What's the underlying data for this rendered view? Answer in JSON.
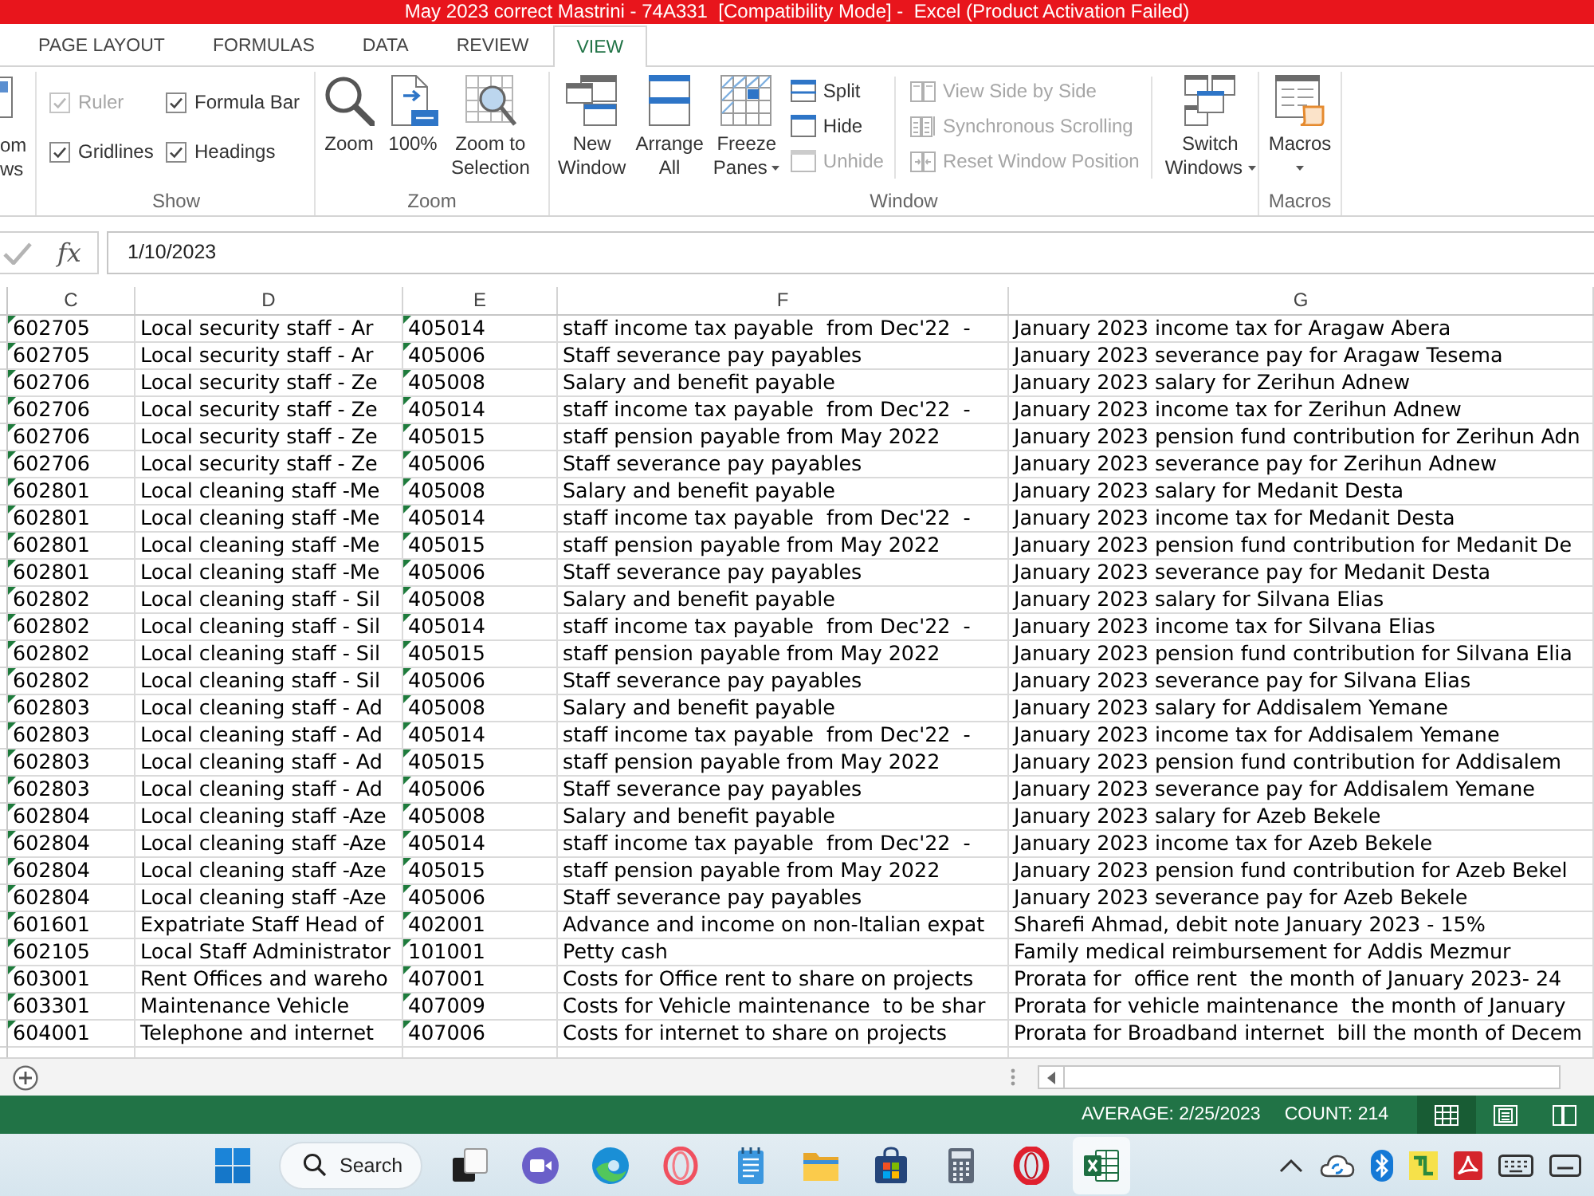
{
  "window": {
    "title": "May 2023 correct Mastrini - 74A331  [Compatibility Mode] -  Excel (Product Activation Failed)"
  },
  "ribbon": {
    "tabs": [
      {
        "label": "PAGE LAYOUT",
        "selected": false
      },
      {
        "label": "FORMULAS",
        "selected": false
      },
      {
        "label": "DATA",
        "selected": false
      },
      {
        "label": "REVIEW",
        "selected": false
      },
      {
        "label": "VIEW",
        "selected": true
      }
    ],
    "cut_button": {
      "lines": [
        "om",
        "ws"
      ]
    },
    "show": {
      "title": "Show",
      "options": [
        {
          "label": "Ruler",
          "checked": true,
          "disabled": true
        },
        {
          "label": "Formula Bar",
          "checked": true,
          "disabled": false
        },
        {
          "label": "Gridlines",
          "checked": true,
          "disabled": false
        },
        {
          "label": "Headings",
          "checked": true,
          "disabled": false
        }
      ]
    },
    "zoom": {
      "title": "Zoom",
      "buttons": [
        {
          "lines": [
            "Zoom"
          ]
        },
        {
          "lines": [
            "100%"
          ]
        },
        {
          "lines": [
            "Zoom to",
            "Selection"
          ]
        }
      ]
    },
    "window": {
      "title": "Window",
      "large": [
        {
          "lines": [
            "New",
            "Window"
          ],
          "dropdown": false
        },
        {
          "lines": [
            "Arrange",
            "All"
          ],
          "dropdown": false
        },
        {
          "lines": [
            "Freeze",
            "Panes"
          ],
          "dropdown": true
        }
      ],
      "small": [
        {
          "label": "Split",
          "disabled": false
        },
        {
          "label": "Hide",
          "disabled": false
        },
        {
          "label": "Unhide",
          "disabled": true
        }
      ],
      "compare": [
        {
          "label": "View Side by Side",
          "disabled": true
        },
        {
          "label": "Synchronous Scrolling",
          "disabled": true
        },
        {
          "label": "Reset Window Position",
          "disabled": true
        }
      ],
      "switch": {
        "lines": [
          "Switch",
          "Windows"
        ],
        "dropdown": true
      }
    },
    "macros": {
      "title": "Macros",
      "button": {
        "lines": [
          "Macros"
        ],
        "dropdown": true
      }
    }
  },
  "formula_bar": {
    "enter_disabled": true,
    "function_label": "fx",
    "value": "1/10/2023"
  },
  "table": {
    "columns": [
      {
        "label": "C",
        "flagged": true
      },
      {
        "label": "D",
        "flagged": false
      },
      {
        "label": "E",
        "flagged": true
      },
      {
        "label": "F",
        "flagged": false
      },
      {
        "label": "G",
        "flagged": false
      }
    ],
    "rows": [
      [
        "602705",
        "Local security staff - Ar",
        "405014",
        "staff income tax payable  from Dec'22  -",
        "January 2023 income tax for Aragaw Abera"
      ],
      [
        "602705",
        "Local security staff - Ar",
        "405006",
        "Staff severance pay payables",
        "January 2023 severance pay for Aragaw Tesema"
      ],
      [
        "602706",
        "Local security staff - Ze",
        "405008",
        "Salary and benefit payable",
        "January 2023 salary for Zerihun Adnew"
      ],
      [
        "602706",
        "Local security staff - Ze",
        "405014",
        "staff income tax payable  from Dec'22  -",
        "January 2023 income tax for Zerihun Adnew"
      ],
      [
        "602706",
        "Local security staff - Ze",
        "405015",
        "staff pension payable from May 2022",
        "January 2023 pension fund contribution for Zerihun Adn"
      ],
      [
        "602706",
        "Local security staff - Ze",
        "405006",
        "Staff severance pay payables",
        "January 2023 severance pay for Zerihun Adnew"
      ],
      [
        "602801",
        "Local cleaning staff -Me",
        "405008",
        "Salary and benefit payable",
        "January 2023 salary for Medanit Desta"
      ],
      [
        "602801",
        "Local cleaning staff -Me",
        "405014",
        "staff income tax payable  from Dec'22  -",
        "January 2023 income tax for Medanit Desta"
      ],
      [
        "602801",
        "Local cleaning staff -Me",
        "405015",
        "staff pension payable from May 2022",
        "January 2023 pension fund contribution for Medanit De"
      ],
      [
        "602801",
        "Local cleaning staff -Me",
        "405006",
        "Staff severance pay payables",
        "January 2023 severance pay for Medanit Desta"
      ],
      [
        "602802",
        "Local cleaning staff - Sil",
        "405008",
        "Salary and benefit payable",
        "January 2023 salary for Silvana Elias"
      ],
      [
        "602802",
        "Local cleaning staff - Sil",
        "405014",
        "staff income tax payable  from Dec'22  -",
        "January 2023 income tax for Silvana Elias"
      ],
      [
        "602802",
        "Local cleaning staff - Sil",
        "405015",
        "staff pension payable from May 2022",
        "January 2023 pension fund contribution for Silvana Elia"
      ],
      [
        "602802",
        "Local cleaning staff - Sil",
        "405006",
        "Staff severance pay payables",
        "January 2023 severance pay for Silvana Elias"
      ],
      [
        "602803",
        "Local cleaning staff - Ad",
        "405008",
        "Salary and benefit payable",
        "January 2023 salary for Addisalem Yemane"
      ],
      [
        "602803",
        "Local cleaning staff - Ad",
        "405014",
        "staff income tax payable  from Dec'22  -",
        "January 2023 income tax for Addisalem Yemane"
      ],
      [
        "602803",
        "Local cleaning staff - Ad",
        "405015",
        "staff pension payable from May 2022",
        "January 2023 pension fund contribution for Addisalem"
      ],
      [
        "602803",
        "Local cleaning staff - Ad",
        "405006",
        "Staff severance pay payables",
        "January 2023 severance pay for Addisalem Yemane"
      ],
      [
        "602804",
        "Local cleaning staff -Aze",
        "405008",
        "Salary and benefit payable",
        "January 2023 salary for Azeb Bekele"
      ],
      [
        "602804",
        "Local cleaning staff -Aze",
        "405014",
        "staff income tax payable  from Dec'22  -",
        "January 2023 income tax for Azeb Bekele"
      ],
      [
        "602804",
        "Local cleaning staff -Aze",
        "405015",
        "staff pension payable from May 2022",
        "January 2023 pension fund contribution for Azeb Bekel"
      ],
      [
        "602804",
        "Local cleaning staff -Aze",
        "405006",
        "Staff severance pay payables",
        "January 2023 severance pay for Azeb Bekele"
      ],
      [
        "601601",
        "Expatriate Staff Head of",
        "402001",
        "Advance and income on non-Italian expat",
        "Sharefi Ahmad, debit note January 2023 - 15%"
      ],
      [
        "602105",
        "Local Staff Administrator",
        "101001",
        "Petty cash",
        "Family medical reimbursement for Addis Mezmur"
      ],
      [
        "603001",
        "Rent Offices and wareho",
        "407001",
        "Costs for Office rent to share on projects",
        "Prorata for  office rent  the month of January 2023- 24"
      ],
      [
        "603301",
        "Maintenance Vehicle",
        "407009",
        "Costs for Vehicle maintenance  to be shar",
        "Prorata for vehicle maintenance  the month of January"
      ],
      [
        "604001",
        "Telephone and internet",
        "407006",
        "Costs for internet to share on projects",
        "Prorata for Broadband internet  bill the month of Decem"
      ]
    ]
  },
  "status_bar": {
    "stats": [
      "AVERAGE: 2/25/2023",
      "COUNT: 214"
    ],
    "views": [
      {
        "kind": "normal",
        "selected": true
      },
      {
        "kind": "page_layout",
        "selected": false
      },
      {
        "kind": "page_break",
        "selected": false
      }
    ]
  },
  "taskbar": {
    "apps": [
      {
        "kind": "start",
        "active": false
      },
      {
        "kind": "search",
        "label": "Search",
        "active": false
      },
      {
        "kind": "task_view",
        "active": false
      },
      {
        "kind": "chat",
        "active": false
      },
      {
        "kind": "edge",
        "active": false
      },
      {
        "kind": "ring",
        "active": false
      },
      {
        "kind": "notepad",
        "active": false
      },
      {
        "kind": "explorer",
        "active": false
      },
      {
        "kind": "store",
        "active": false
      },
      {
        "kind": "calculator",
        "active": false
      },
      {
        "kind": "opera",
        "active": false
      },
      {
        "kind": "excel",
        "active": true
      }
    ]
  }
}
